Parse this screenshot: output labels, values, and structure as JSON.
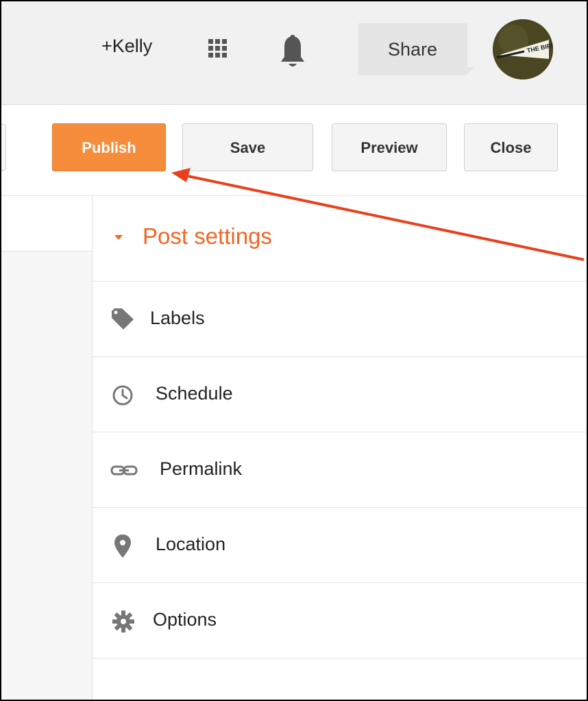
{
  "topbar": {
    "user_label": "+Kelly",
    "share_label": "Share",
    "avatar_text": "THE BIRD",
    "icons": [
      "apps-grid-icon",
      "notification-bell-icon"
    ]
  },
  "toolbar": {
    "publish_label": "Publish",
    "save_label": "Save",
    "preview_label": "Preview",
    "close_label": "Close"
  },
  "settings": {
    "title": "Post settings",
    "items": [
      {
        "label": "Labels",
        "icon": "tag-icon"
      },
      {
        "label": "Schedule",
        "icon": "clock-icon"
      },
      {
        "label": "Permalink",
        "icon": "link-icon"
      },
      {
        "label": "Location",
        "icon": "map-pin-icon"
      },
      {
        "label": "Options",
        "icon": "gear-icon"
      }
    ]
  },
  "colors": {
    "accent": "#f26522",
    "publish_bg": "#f58d3c",
    "annotation_arrow": "#e8401c"
  }
}
